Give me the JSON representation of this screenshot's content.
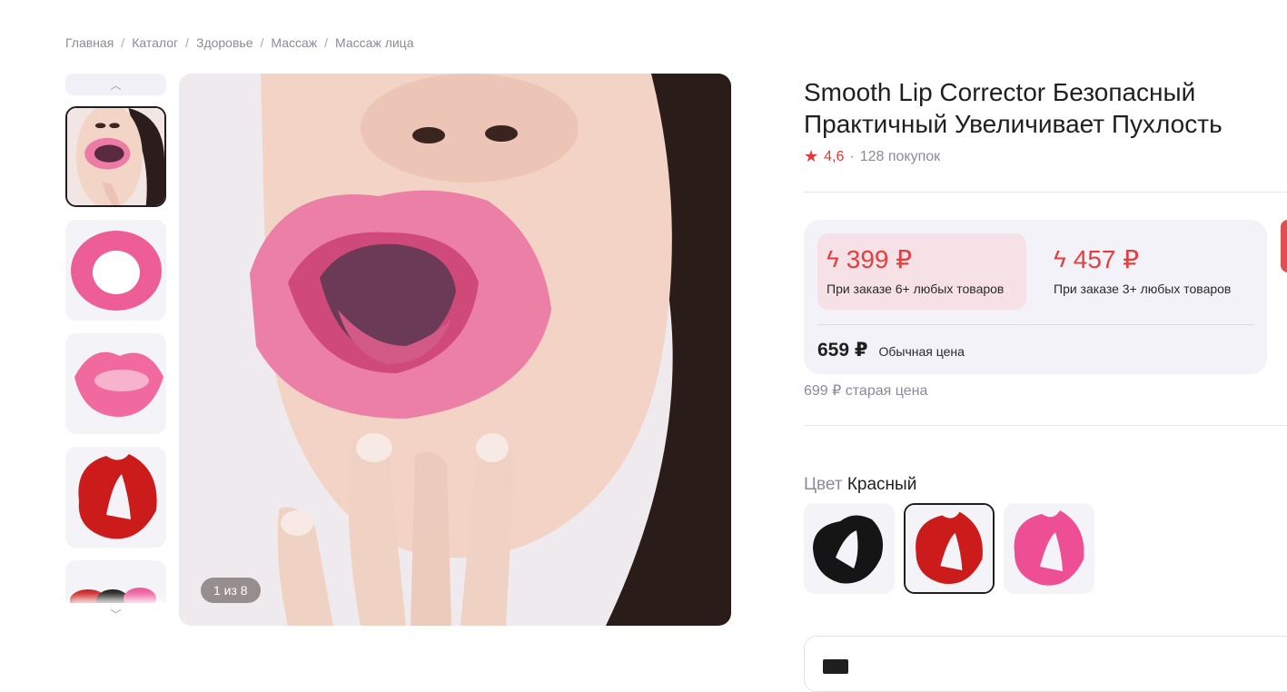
{
  "breadcrumb": [
    "Главная",
    "Каталог",
    "Здоровье",
    "Массаж",
    "Массаж лица"
  ],
  "breadcrumb_separator": "/",
  "gallery": {
    "counter": "1 из 8",
    "thumbnails": [
      "face-photo",
      "pink-ring",
      "pink-lips",
      "red-lips",
      "multi-color"
    ],
    "selected_index": 0
  },
  "product": {
    "title": "Smooth Lip Corrector Безопасный Практичный Увеличивает Пухлость",
    "rating": "4,6",
    "rating_separator": "·",
    "purchases": "128 покупок"
  },
  "pricing": {
    "offers": [
      {
        "price": "399 ₽",
        "condition": "При заказе 6+ любых товаров"
      },
      {
        "price": "457 ₽",
        "condition": "При заказе 3+ любых товаров"
      }
    ],
    "regular_price": "659 ₽",
    "regular_label": "Обычная цена",
    "old_price": "699 ₽ старая цена"
  },
  "color": {
    "label": "Цвет",
    "selected": "Красный",
    "options": [
      "black",
      "red",
      "pink"
    ],
    "selected_index": 1
  },
  "colors": {
    "accent": "#e53e3e",
    "offer_highlight": "#f5e1e6",
    "panel_bg": "#f3f2f8"
  }
}
